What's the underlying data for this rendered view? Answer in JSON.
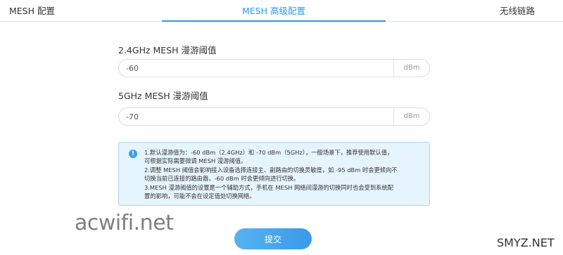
{
  "tabs": [
    {
      "label": "MESH 配置",
      "active": false
    },
    {
      "label": "MESH 高级配置",
      "active": true
    },
    {
      "label": "无线链路",
      "active": false
    }
  ],
  "fields": [
    {
      "label": "2.4GHz MESH 漫游阈值",
      "value": "-60",
      "unit": "dBm"
    },
    {
      "label": "5GHz MESH 漫游阈值",
      "value": "-70",
      "unit": "dBm"
    }
  ],
  "notice": {
    "icon": "info-icon",
    "lines": [
      "1.默认漫游值为：-60 dBm（2.4GHz）和 -70 dBm（5GHz），一般场景下，推荐使用默认值，",
      "可根据实际需要微调 MESH 漫游阈值。",
      "2.调整 MESH 阈值会影响接入设备选择连接主、副路由的切换灵敏度，如 -95 dBm 时会更倾向不",
      "切换当前已连接的路由器，-60 dBm 时会更倾向进行切换。",
      "3.MESH 漫游阈值的设置是一个辅助方式，手机在 MESH 网络间漫游的切换同时也会受到系统配",
      "置的影响，可能不会在设定值处切换网络。"
    ]
  },
  "submit_label": "提交",
  "watermarks": {
    "left": "acwifi.net",
    "right": "SMYZ.NET"
  },
  "colors": {
    "accent": "#2b9ae8",
    "notice_bg": "#e6f4fd",
    "notice_border": "#a9d6f5"
  }
}
